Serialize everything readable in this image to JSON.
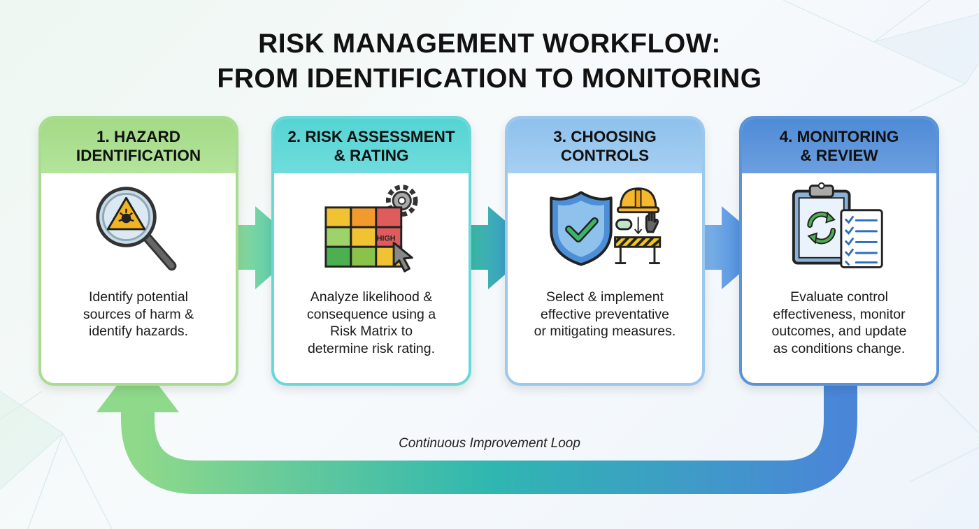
{
  "title": {
    "line1": "RISK MANAGEMENT WORKFLOW:",
    "line2": "FROM IDENTIFICATION TO MONITORING"
  },
  "steps": [
    {
      "header_line1": "1. HAZARD",
      "header_line2": "IDENTIFICATION",
      "icon": "magnifier-hazard-icon",
      "desc_lines": [
        "Identify potential",
        "sources of harm &",
        "identify hazards."
      ]
    },
    {
      "header_line1": "2. RISK ASSESSMENT",
      "header_line2": "& RATING",
      "icon": "risk-matrix-icon",
      "icon_label": "HIGH",
      "desc_lines": [
        "Analyze likelihood &",
        "consequence using a",
        "Risk Matrix to",
        "determine risk rating."
      ]
    },
    {
      "header_line1": "3. CHOOSING",
      "header_line2": "CONTROLS",
      "icon": "shield-controls-icon",
      "desc_lines": [
        "Select & implement",
        "effective preventative",
        "or mitigating measures."
      ]
    },
    {
      "header_line1": "4. MONITORING",
      "header_line2": "& REVIEW",
      "icon": "clipboard-review-icon",
      "desc_lines": [
        "Evaluate control",
        "effectiveness, monitor",
        "outcomes, and update",
        "as conditions change."
      ]
    }
  ],
  "loop_label": "Continuous Improvement Loop",
  "colors": {
    "step1": "#a4da87",
    "step2": "#55d4d4",
    "step3": "#8ec1ec",
    "step4": "#4f8bd6",
    "loop_start": "#8fd98a",
    "loop_end": "#4a86d8"
  }
}
